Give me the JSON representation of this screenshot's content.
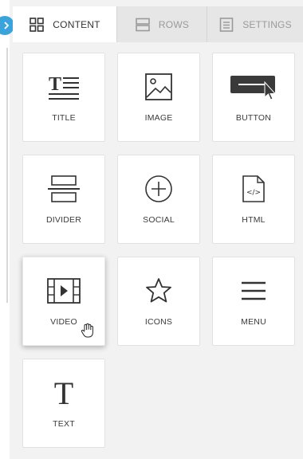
{
  "tabs": [
    {
      "label": "CONTENT",
      "icon": "grid-icon",
      "active": true
    },
    {
      "label": "ROWS",
      "icon": "rows-icon",
      "active": false
    },
    {
      "label": "SETTINGS",
      "icon": "settings-document-icon",
      "active": false
    }
  ],
  "blocks": [
    {
      "label": "TITLE",
      "icon": "title-text-icon"
    },
    {
      "label": "IMAGE",
      "icon": "image-icon"
    },
    {
      "label": "BUTTON",
      "icon": "button-icon"
    },
    {
      "label": "DIVIDER",
      "icon": "divider-icon"
    },
    {
      "label": "SOCIAL",
      "icon": "plus-circle-icon"
    },
    {
      "label": "HTML",
      "icon": "html-file-icon"
    },
    {
      "label": "VIDEO",
      "icon": "video-film-icon"
    },
    {
      "label": "ICONS",
      "icon": "star-icon"
    },
    {
      "label": "MENU",
      "icon": "hamburger-menu-icon"
    },
    {
      "label": "TEXT",
      "icon": "text-t-icon"
    }
  ],
  "colors": {
    "accent": "#3aa3dc",
    "panel": "#f2f2f2",
    "tile": "#ffffff",
    "tab_inactive": "#e6e6e6",
    "text": "#3b3b3b"
  }
}
